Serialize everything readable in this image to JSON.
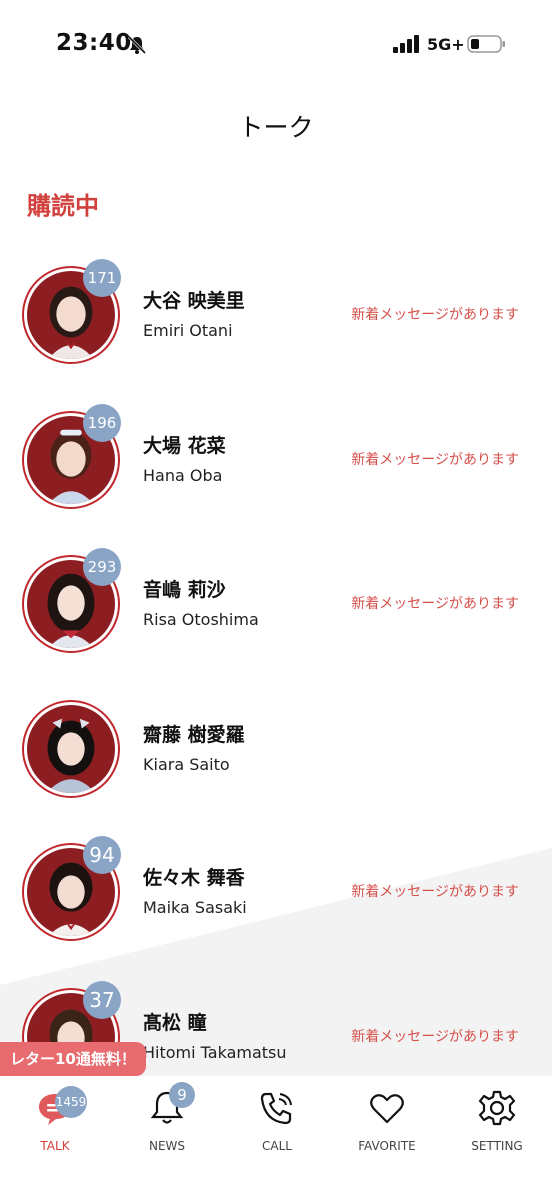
{
  "status_bar": {
    "time": "23:40",
    "network": "5G+"
  },
  "header": {
    "title": "トーク"
  },
  "section": {
    "label": "購読中"
  },
  "talks": [
    {
      "name_jp": "大谷 映美里",
      "name_en": "Emiri Otani",
      "unread": "171",
      "status": "新着メッセージがあります"
    },
    {
      "name_jp": "大場 花菜",
      "name_en": "Hana Oba",
      "unread": "196",
      "status": "新着メッセージがあります"
    },
    {
      "name_jp": "音嶋 莉沙",
      "name_en": "Risa Otoshima",
      "unread": "293",
      "status": "新着メッセージがあります"
    },
    {
      "name_jp": "齋藤 樹愛羅",
      "name_en": "Kiara Saito",
      "unread": "",
      "status": ""
    },
    {
      "name_jp": "佐々木 舞香",
      "name_en": "Maika Sasaki",
      "unread": "94",
      "status": "新着メッセージがあります"
    },
    {
      "name_jp": "髙松 瞳",
      "name_en": "Hitomi Takamatsu",
      "unread": "37",
      "status": "新着メッセージがあります"
    }
  ],
  "promo": {
    "text": "レター10通無料！"
  },
  "tab_bar": {
    "talk": {
      "label": "TALK",
      "badge": "1459"
    },
    "news": {
      "label": "NEWS",
      "badge": "9"
    },
    "call": {
      "label": "CALL"
    },
    "favorite": {
      "label": "FAVORITE"
    },
    "setting": {
      "label": "SETTING"
    }
  },
  "colors": {
    "accent": "#d1403d",
    "badge": "#8aa4c6",
    "avatar_bg": "#8c1e22",
    "promo": "#e76b6f"
  }
}
